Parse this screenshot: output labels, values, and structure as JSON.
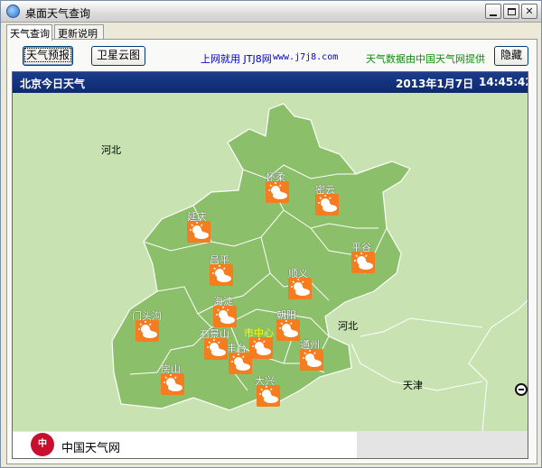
{
  "window": {
    "title": "桌面天气查询"
  },
  "tabs": [
    {
      "label": "天气查询"
    },
    {
      "label": "更新说明"
    }
  ],
  "toolbar": {
    "forecast_label": "天气预报",
    "satellite_label": "卫星云图",
    "link_text": "上网就用 JTJ8网",
    "link_url_text": "www.j7j8.com",
    "source_text": "天气数据由中国天气网提供",
    "hide_label": "隐藏"
  },
  "map": {
    "header_title": "北京今日天气",
    "date": "2013年1月7日",
    "time": "14:45:42",
    "outside_labels": {
      "hebei_nw": "河北",
      "hebei_e": "河北",
      "tianjin": "天津"
    },
    "districts": [
      {
        "name": "怀柔",
        "weather": "sunny-cloudy-icon"
      },
      {
        "name": "密云",
        "weather": "sunny-cloudy-icon"
      },
      {
        "name": "延庆",
        "weather": "sunny-cloudy-icon"
      },
      {
        "name": "平谷",
        "weather": "sunny-cloudy-icon"
      },
      {
        "name": "昌平",
        "weather": "sunny-cloudy-icon"
      },
      {
        "name": "顺义",
        "weather": "sunny-cloudy-icon"
      },
      {
        "name": "海淀",
        "weather": "sunny-cloudy-icon"
      },
      {
        "name": "门头沟",
        "weather": "sunny-cloudy-icon"
      },
      {
        "name": "朝阳",
        "weather": "sunny-cloudy-icon"
      },
      {
        "name": "市中心",
        "weather": "sunny-cloudy-icon"
      },
      {
        "name": "石景山",
        "weather": "sunny-cloudy-icon"
      },
      {
        "name": "丰台",
        "weather": "sunny-cloudy-icon"
      },
      {
        "name": "通州",
        "weather": "sunny-cloudy-icon"
      },
      {
        "name": "房山",
        "weather": "sunny-cloudy-icon"
      },
      {
        "name": "大兴",
        "weather": "sunny-cloudy-icon"
      }
    ],
    "footer_text": "中国天气网",
    "logo_text": "中"
  },
  "colors": {
    "header_blue": "#0e2a6e",
    "map_land": "#8cbf6a",
    "map_background": "#c8e3b1",
    "icon_orange": "#f57c1f",
    "link_blue": "#0000cc",
    "source_green": "#128a12",
    "center_label": "#ffff00"
  }
}
